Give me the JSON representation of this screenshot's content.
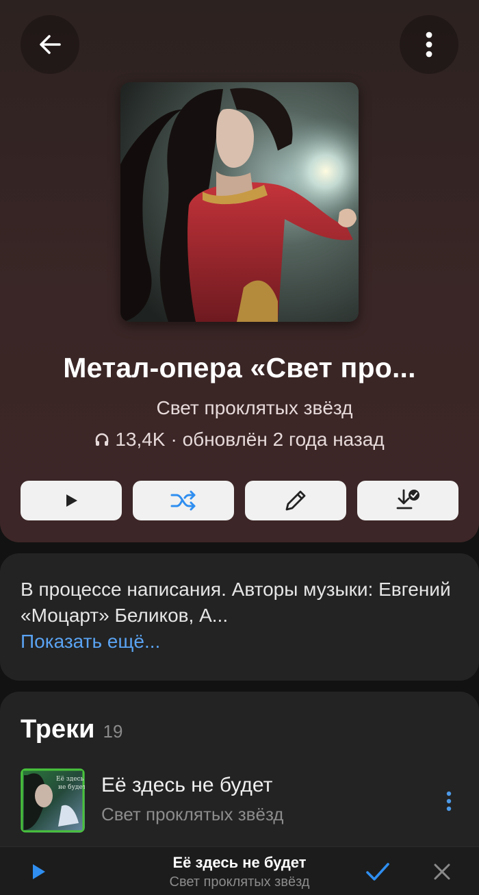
{
  "playlist": {
    "title": "Метал-опера «Свет про...",
    "author": "Свет проклятых звёзд",
    "listens": "13,4K",
    "updated": "· обновлён 2 года назад"
  },
  "icons": {
    "back": "arrow-left-icon",
    "more": "more-vertical-icon",
    "play": "play-icon",
    "shuffle": "shuffle-icon",
    "edit": "pencil-icon",
    "download": "download-done-icon",
    "headphones": "headphones-icon",
    "check": "check-icon",
    "close": "close-icon"
  },
  "description": {
    "text": "В процессе написания.  Авторы музыки: Евгений «Моцарт» Беликов, А...",
    "show_more": "Показать ещё..."
  },
  "tracks": {
    "title": "Треки",
    "count": "19",
    "items": [
      {
        "title": "Её здесь не будет",
        "artist": "Свет проклятых звёзд"
      }
    ]
  },
  "player": {
    "title": "Её здесь не будет",
    "artist": "Свет проклятых звёзд"
  },
  "colors": {
    "accent": "#5aa3f2",
    "header_bg": "#3a2626",
    "card_bg": "#232323",
    "page_bg": "#121212"
  }
}
